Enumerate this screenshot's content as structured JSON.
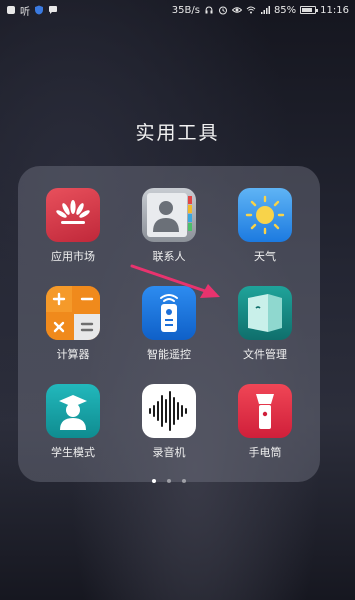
{
  "status_bar": {
    "left_text": "听",
    "network_speed": "35B/s",
    "battery_percent": "85%",
    "time": "11:16",
    "battery_level": 0.85
  },
  "folder": {
    "title": "实用工具",
    "apps": [
      {
        "label": "应用市场",
        "icon": "app-market-icon",
        "color": "#d63a4a"
      },
      {
        "label": "联系人",
        "icon": "contacts-icon",
        "color": "#9aa0a8"
      },
      {
        "label": "天气",
        "icon": "weather-icon",
        "color": "#2f8fe8"
      },
      {
        "label": "计算器",
        "icon": "calculator-icon",
        "color": "#f08a1c"
      },
      {
        "label": "智能遥控",
        "icon": "remote-control-icon",
        "color": "#1a7be0"
      },
      {
        "label": "文件管理",
        "icon": "file-manager-icon",
        "color": "#1a8f8a"
      },
      {
        "label": "学生模式",
        "icon": "student-mode-icon",
        "color": "#16a3a6"
      },
      {
        "label": "录音机",
        "icon": "recorder-icon",
        "color": "#ffffff"
      },
      {
        "label": "手电筒",
        "icon": "flashlight-icon",
        "color": "#e8324a"
      }
    ],
    "page_count": 3,
    "active_page": 1
  },
  "annotation": {
    "arrow_color": "#e8336e"
  }
}
